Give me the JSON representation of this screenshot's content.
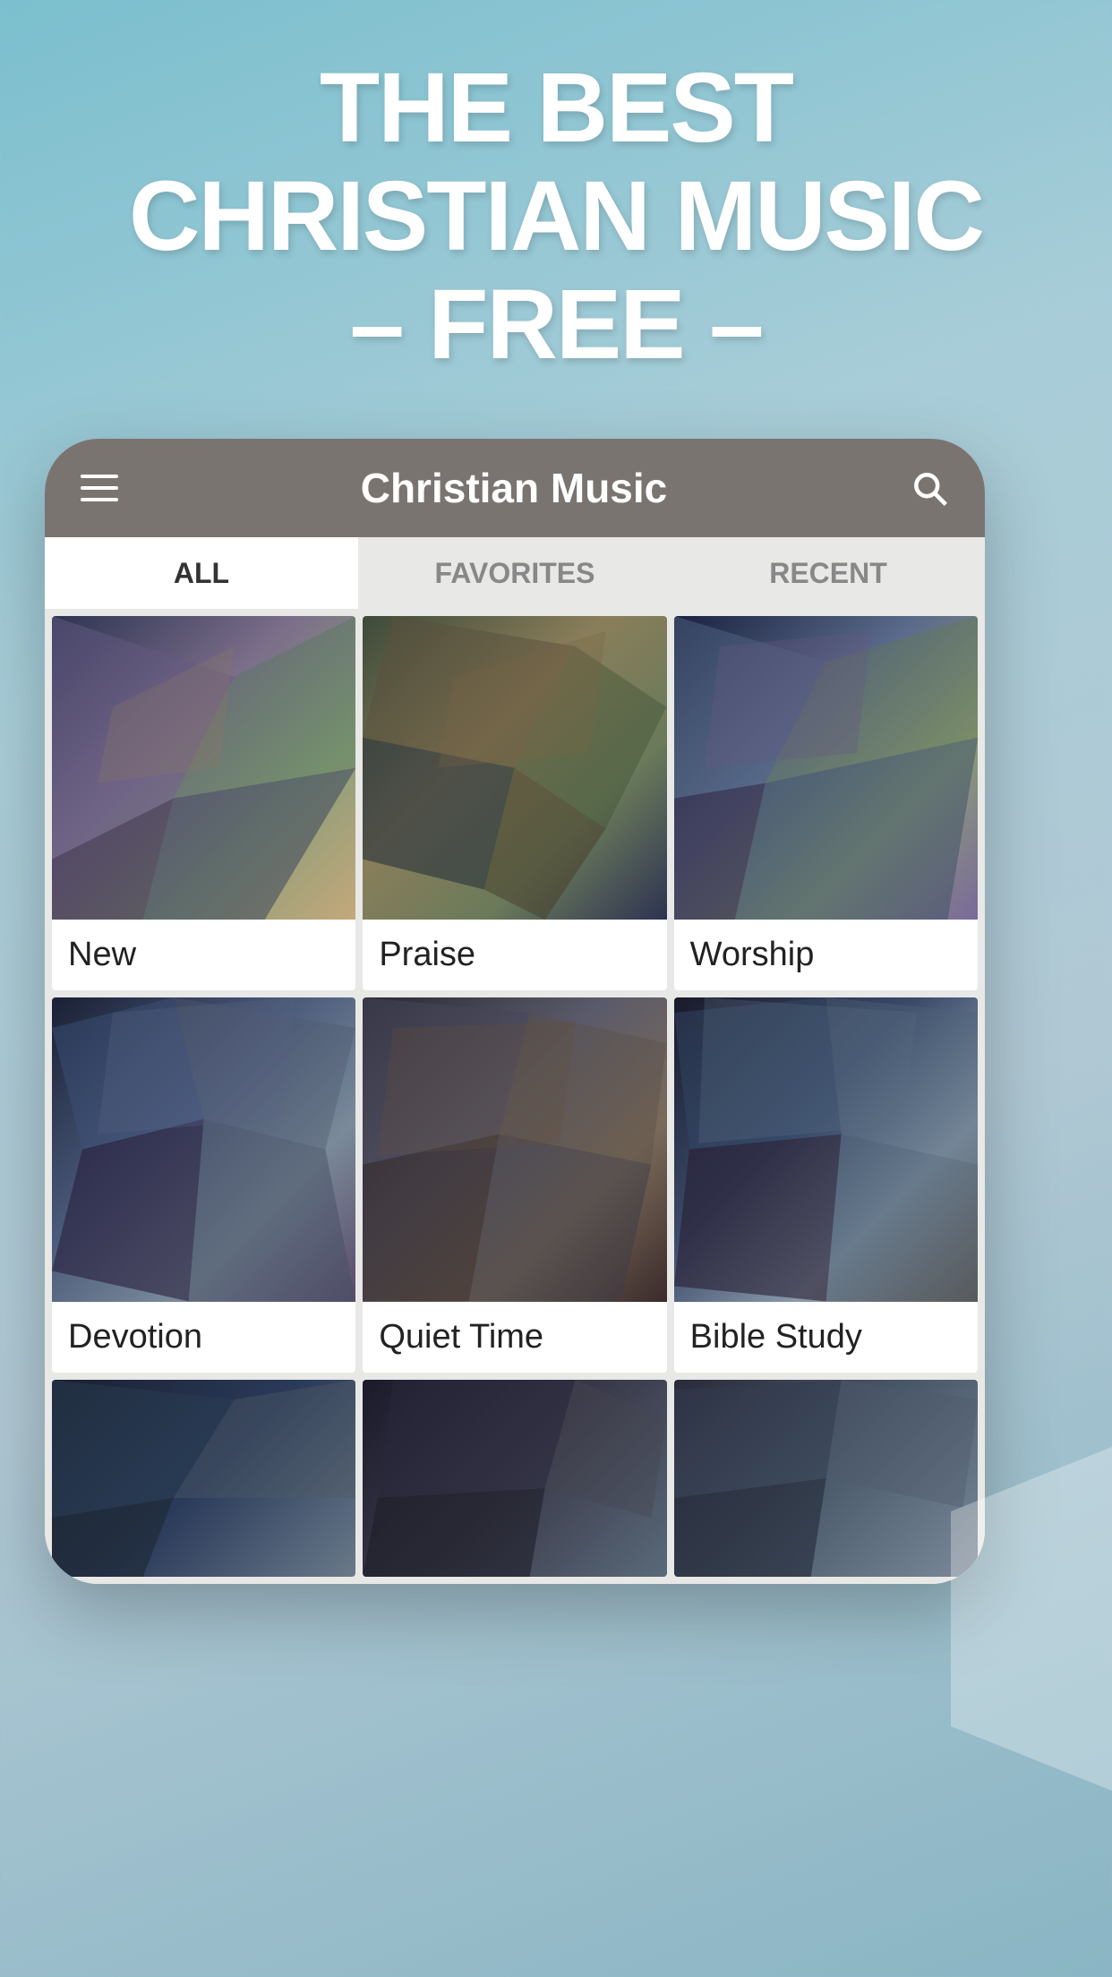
{
  "hero": {
    "line1": "THE BEST",
    "line2": "CHRISTIAN MUSIC",
    "line3": "– FREE –"
  },
  "app": {
    "title": "Christian Music"
  },
  "tabs": [
    {
      "id": "all",
      "label": "ALL",
      "active": true
    },
    {
      "id": "favorites",
      "label": "FAVORITES",
      "active": false
    },
    {
      "id": "recent",
      "label": "RECENT",
      "active": false
    }
  ],
  "categories": [
    {
      "id": "new",
      "label": "New",
      "poly": "poly-1"
    },
    {
      "id": "praise",
      "label": "Praise",
      "poly": "poly-2"
    },
    {
      "id": "worship",
      "label": "Worship",
      "poly": "poly-3"
    },
    {
      "id": "devotion",
      "label": "Devotion",
      "poly": "poly-4"
    },
    {
      "id": "quiet-time",
      "label": "Quiet Time",
      "poly": "poly-5"
    },
    {
      "id": "bible-study",
      "label": "Bible Study",
      "poly": "poly-6"
    }
  ],
  "partial_categories": [
    {
      "id": "cat7",
      "poly": "poly-7"
    },
    {
      "id": "cat8",
      "poly": "poly-8"
    },
    {
      "id": "cat9",
      "poly": "poly-9"
    }
  ]
}
